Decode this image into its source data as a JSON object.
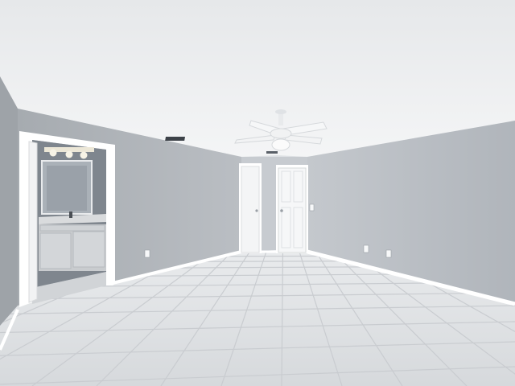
{
  "scene": {
    "colors": {
      "ceiling": "#eef0f1",
      "wall_left": "#aeb3b8",
      "wall_back": "#c3c7cc",
      "wall_right": "#b8bdc3",
      "wall_far_left": "#9ea3a8",
      "floor": "#e6e8ea",
      "grout": "#c9ccd0",
      "trim": "#ffffff",
      "door": "#f4f5f6",
      "mirror": "#9ea5ad",
      "cabinet": "#c9cccf",
      "counter": "#d7d9db",
      "vanity_light": "#f7f3e6",
      "fan": "#f6f7f8"
    },
    "icons": [
      "ceiling-fan-icon",
      "outlet-icon",
      "light-switch-icon",
      "air-vent-icon",
      "faucet-icon"
    ]
  }
}
